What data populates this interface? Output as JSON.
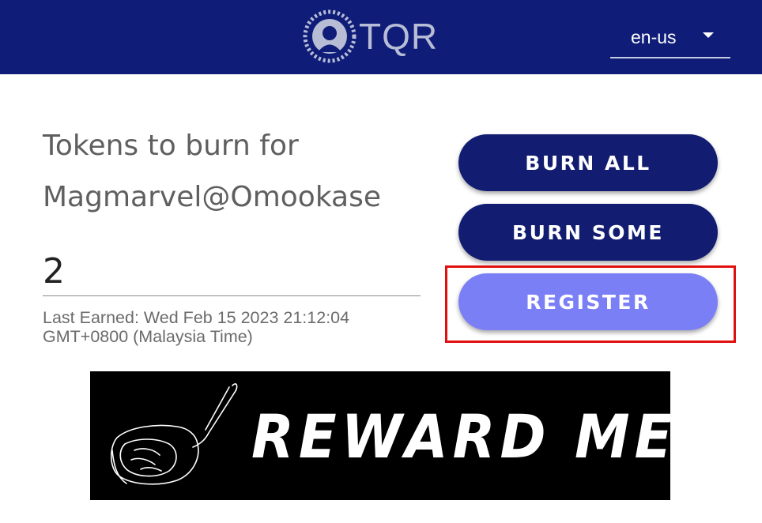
{
  "header": {
    "brand": "TQR",
    "logo_icon": "tqr-logo-icon",
    "language": "en-us",
    "background_color": "#0f1d78"
  },
  "main": {
    "title_line1": "Tokens to burn for",
    "title_line2": "Magmarvel@Omookase",
    "token_count": "2",
    "last_earned_line1": "Last Earned: Wed Feb 15 2023 21:12:04",
    "last_earned_line2": "GMT+0800 (Malaysia Time)"
  },
  "actions": {
    "burn_all_label": "BURN ALL",
    "burn_some_label": "BURN SOME",
    "register_label": "REGISTER",
    "primary_color": "#121d72",
    "register_color": "#7b7ff5",
    "highlight_color": "#e01010"
  },
  "banner": {
    "text": "REWARD MENU",
    "icon": "steak-icon"
  }
}
